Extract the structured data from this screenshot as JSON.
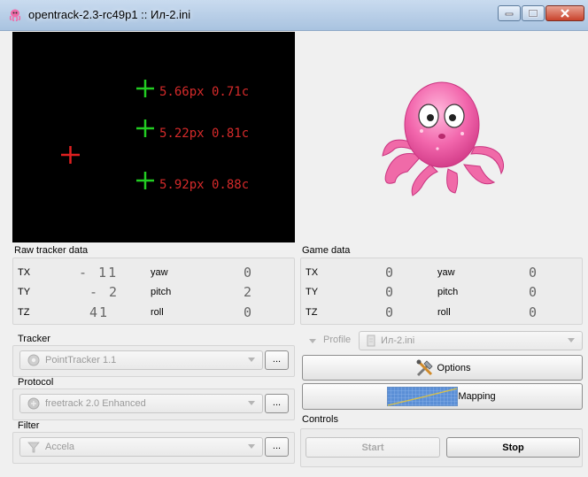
{
  "window": {
    "title": "opentrack-2.3-rc49p1 :: Ил-2.ini"
  },
  "preview": {
    "points": [
      {
        "label": "5.66px 0.71c"
      },
      {
        "label": "5.22px 0.81c"
      },
      {
        "label": "5.92px 0.88c"
      }
    ],
    "colors": {
      "point": "#22cc22",
      "label": "#d42a2a",
      "center": "#e02020"
    }
  },
  "raw_tracker": {
    "title": "Raw tracker data",
    "rows": [
      {
        "axis": "TX",
        "value": "- 11",
        "rot": "yaw",
        "rot_value": "0"
      },
      {
        "axis": "TY",
        "value": "- 2",
        "rot": "pitch",
        "rot_value": "2"
      },
      {
        "axis": "TZ",
        "value": "41",
        "rot": "roll",
        "rot_value": "0"
      }
    ]
  },
  "game_data": {
    "title": "Game data",
    "rows": [
      {
        "axis": "TX",
        "value": "0",
        "rot": "yaw",
        "rot_value": "0"
      },
      {
        "axis": "TY",
        "value": "0",
        "rot": "pitch",
        "rot_value": "0"
      },
      {
        "axis": "TZ",
        "value": "0",
        "rot": "roll",
        "rot_value": "0"
      }
    ]
  },
  "tracker": {
    "title": "Tracker",
    "value": "PointTracker 1.1",
    "more": "..."
  },
  "protocol": {
    "title": "Protocol",
    "value": "freetrack 2.0 Enhanced",
    "more": "..."
  },
  "filter": {
    "title": "Filter",
    "value": "Accela",
    "more": "..."
  },
  "profile": {
    "label": "Profile",
    "value": "Ил-2.ini"
  },
  "buttons": {
    "options": "Options",
    "mapping": "Mapping"
  },
  "controls": {
    "title": "Controls",
    "start": "Start",
    "stop": "Stop"
  }
}
